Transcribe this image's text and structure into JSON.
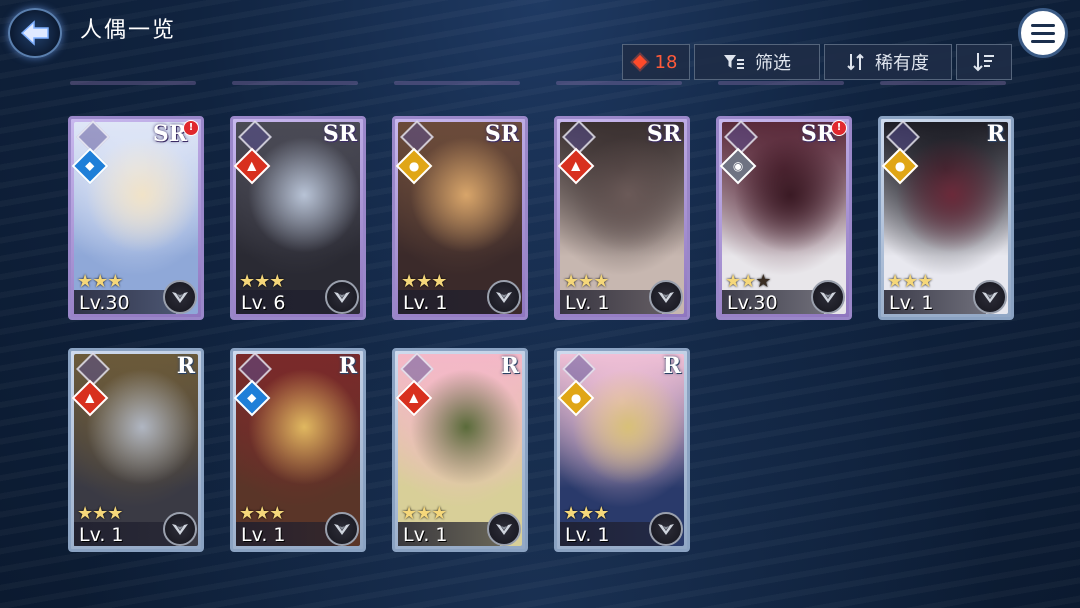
{
  "header": {
    "title": "人偶一览",
    "back_icon": "back-arrow-icon",
    "menu_icon": "hamburger-menu-icon"
  },
  "toolbar": {
    "currency_count": "18",
    "currency_color": "#ff4a2a",
    "filter_label": "筛选",
    "sort_label": "稀有度",
    "order_icon": "sort-descending-icon"
  },
  "dolls": [
    {
      "rarity": "SR",
      "element": "water",
      "stars": 3,
      "max_stars": 3,
      "level": "Lv.30",
      "notify": true,
      "palette": [
        "#dfe6f7",
        "#8fa8d8",
        "#f1e3c8"
      ]
    },
    {
      "rarity": "SR",
      "element": "fire",
      "stars": 3,
      "max_stars": 3,
      "level": "Lv. 6",
      "notify": false,
      "palette": [
        "#4a4a55",
        "#2a2a33",
        "#b8c3d6"
      ]
    },
    {
      "rarity": "SR",
      "element": "light",
      "stars": 3,
      "max_stars": 3,
      "level": "Lv. 1",
      "notify": false,
      "palette": [
        "#6b4b3a",
        "#3b2a2a",
        "#d8a56a"
      ]
    },
    {
      "rarity": "SR",
      "element": "fire",
      "stars": 3,
      "max_stars": 3,
      "level": "Lv. 1",
      "notify": false,
      "palette": [
        "#3a3030",
        "#c7b7b0",
        "#6b5a58"
      ]
    },
    {
      "rarity": "SR",
      "element": "dark",
      "stars": 2,
      "max_stars": 3,
      "level": "Lv.30",
      "notify": true,
      "palette": [
        "#5a2a3a",
        "#e8e6ea",
        "#3a1a24"
      ]
    },
    {
      "rarity": "R",
      "element": "light",
      "stars": 3,
      "max_stars": 3,
      "level": "Lv. 1",
      "notify": false,
      "palette": [
        "#1d1d25",
        "#e8e8ef",
        "#6b2a3a"
      ]
    },
    {
      "rarity": "R",
      "element": "fire",
      "stars": 3,
      "max_stars": 3,
      "level": "Lv. 1",
      "notify": false,
      "palette": [
        "#6b5a3a",
        "#3a3a44",
        "#b0b6c2"
      ]
    },
    {
      "rarity": "R",
      "element": "water",
      "stars": 3,
      "max_stars": 3,
      "level": "Lv. 1",
      "notify": false,
      "palette": [
        "#7a2a2a",
        "#5a3528",
        "#e0b860"
      ]
    },
    {
      "rarity": "R",
      "element": "fire",
      "stars": 3,
      "max_stars": 3,
      "level": "Lv. 1",
      "notify": false,
      "palette": [
        "#f4b8c8",
        "#d8cf98",
        "#5a6b3a"
      ]
    },
    {
      "rarity": "R",
      "element": "light",
      "stars": 3,
      "max_stars": 3,
      "level": "Lv. 1",
      "notify": false,
      "palette": [
        "#f0c0d6",
        "#2a3a6b",
        "#d8c078"
      ]
    }
  ]
}
